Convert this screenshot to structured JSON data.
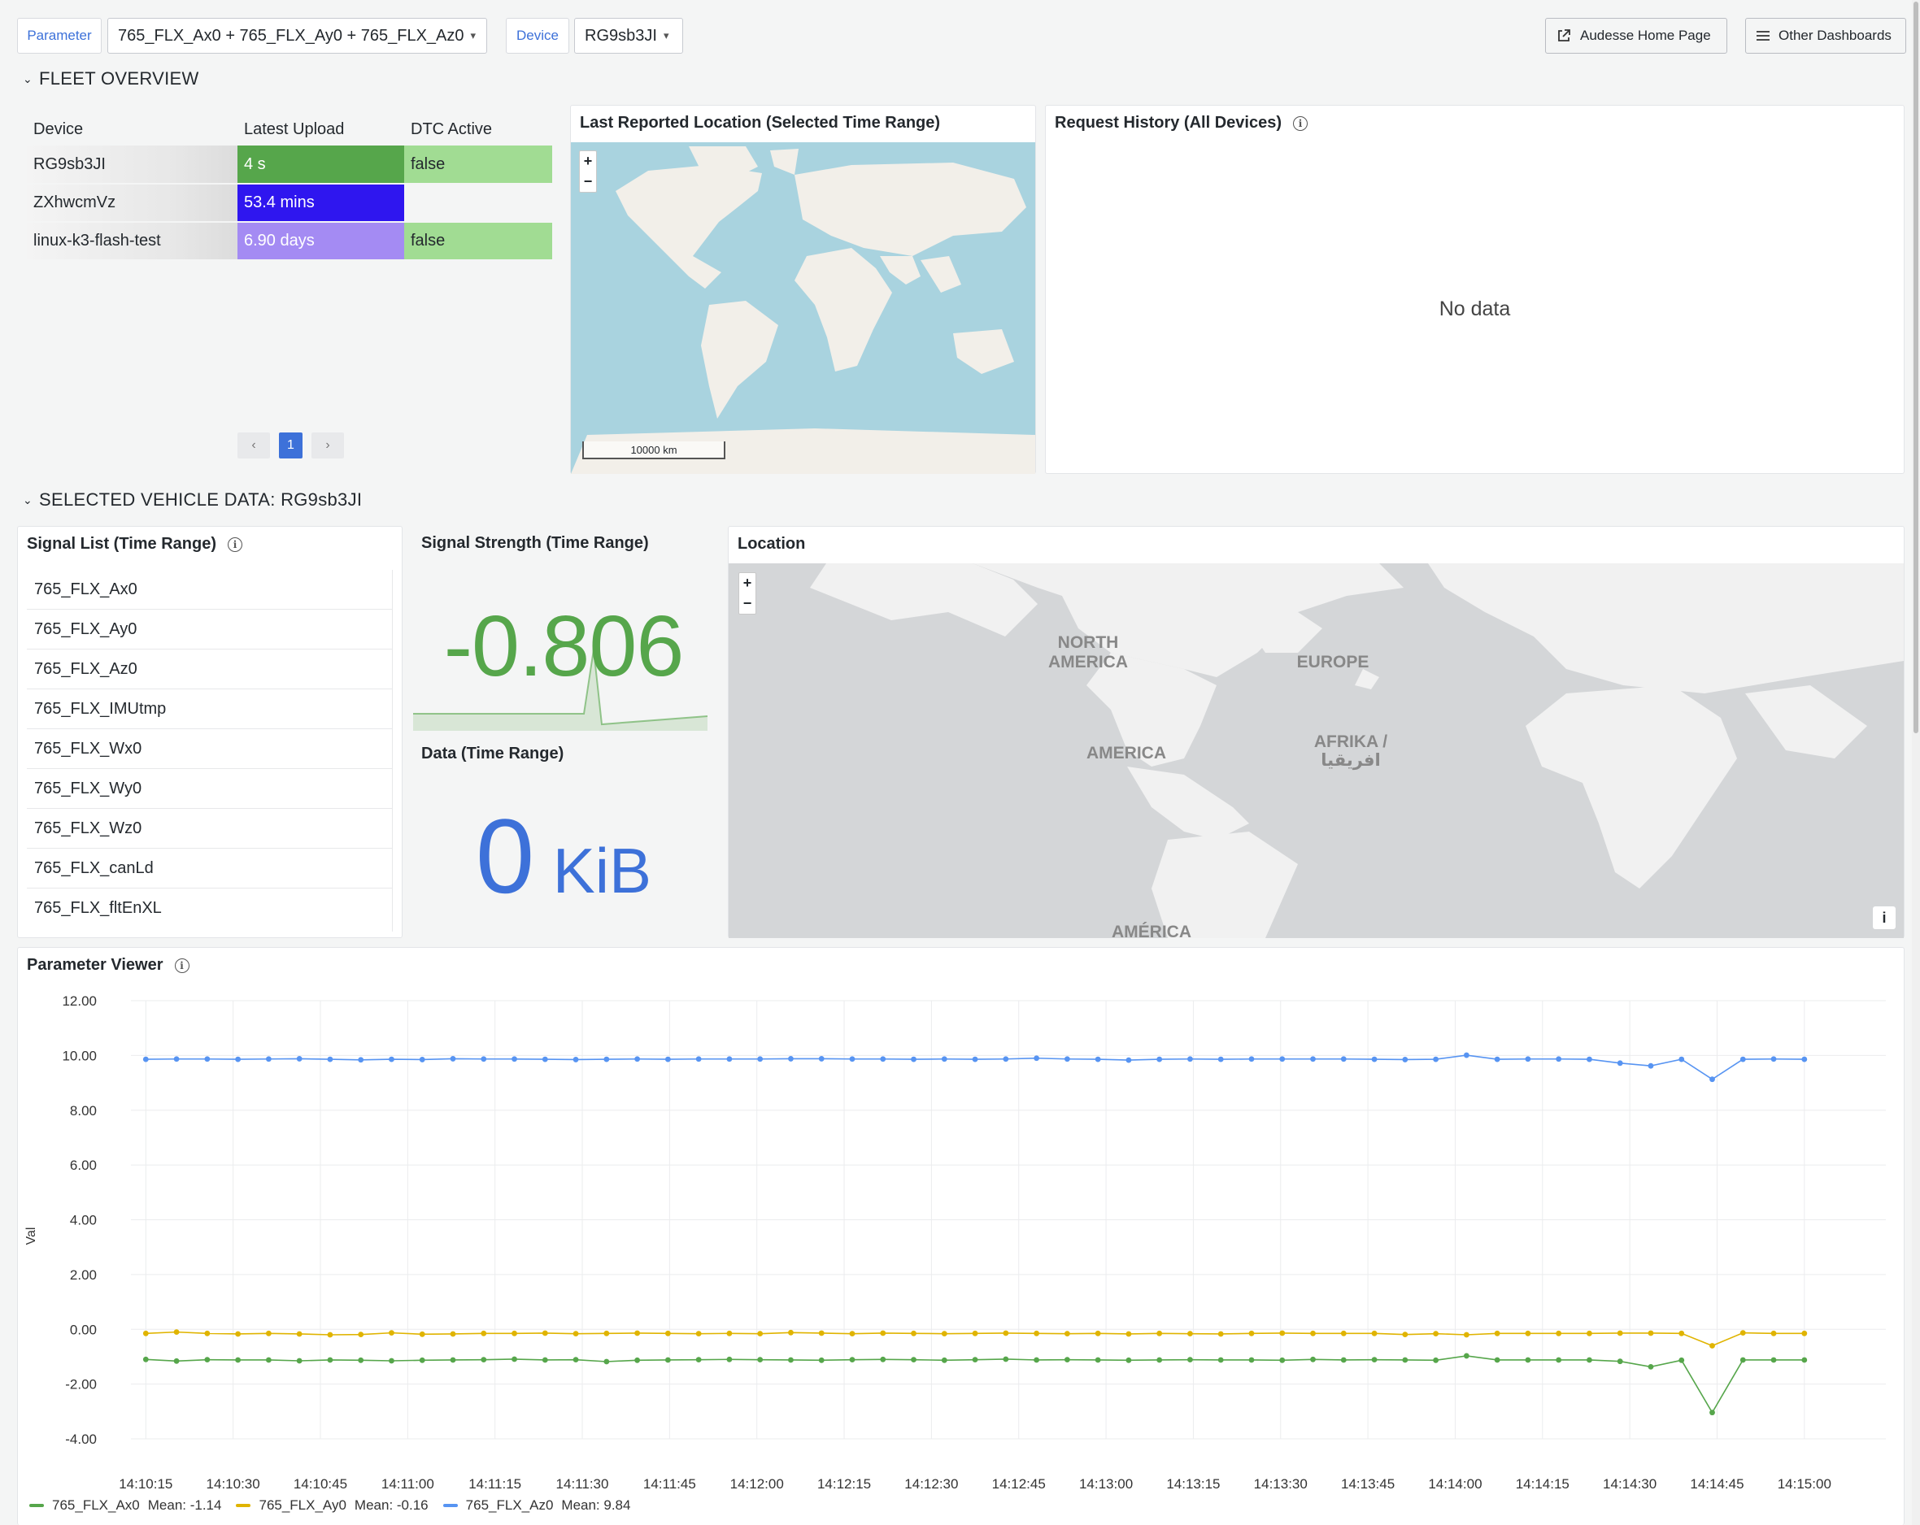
{
  "toolbar": {
    "parameter_label": "Parameter",
    "parameter_value": "765_FLX_Ax0 + 765_FLX_Ay0 + 765_FLX_Az0",
    "device_label": "Device",
    "device_value": "RG9sb3JI",
    "home_button": "Audesse Home Page",
    "dashboards_button": "Other Dashboards"
  },
  "fleet_overview": {
    "title": "FLEET OVERVIEW",
    "table": {
      "headers": [
        "Device",
        "Latest Upload",
        "DTC Active"
      ],
      "rows": [
        {
          "device": "RG9sb3JI",
          "upload": "4 s",
          "dtc": "false",
          "upload_color": "#56a64b",
          "dtc_color": "#a1dc93"
        },
        {
          "device": "ZXhwcmVz",
          "upload": "53.4 mins",
          "dtc": "",
          "upload_color": "#2f16ef",
          "dtc_color": "#f4f5f5"
        },
        {
          "device": "linux-k3-flash-test",
          "upload": "6.90 days",
          "dtc": "false",
          "upload_color": "#a48bf3",
          "dtc_color": "#a1dc93"
        }
      ],
      "page": "1"
    },
    "map_panel": {
      "title": "Last Reported Location (Selected Time Range)",
      "scale": "10000 km",
      "zoom_in": "+",
      "zoom_out": "−"
    },
    "request_panel": {
      "title": "Request History (All Devices)",
      "empty_text": "No data"
    }
  },
  "vehicle": {
    "title": "SELECTED VEHICLE DATA: RG9sb3JI",
    "signal_list": {
      "title": "Signal List (Time Range)",
      "items": [
        "765_FLX_Ax0",
        "765_FLX_Ay0",
        "765_FLX_Az0",
        "765_FLX_IMUtmp",
        "765_FLX_Wx0",
        "765_FLX_Wy0",
        "765_FLX_Wz0",
        "765_FLX_canLd",
        "765_FLX_fltEnXL"
      ]
    },
    "signal_strength": {
      "title": "Signal Strength (Time Range)",
      "value": "-0.806",
      "color": "#56a64b"
    },
    "data_panel": {
      "title": "Data (Time Range)",
      "value": "0",
      "unit": "KiB",
      "color": "#3d71d9"
    },
    "location": {
      "title": "Location",
      "zoom_in": "+",
      "zoom_out": "−",
      "info": "i",
      "labels": {
        "north_america_1": "NORTH",
        "north_america_2": "AMERICA",
        "europe": "EUROPE",
        "america": "AMERICA",
        "afrika_1": "AFRIKA /",
        "afrika_2": "افريقيا",
        "america_bottom": "AMÉRICA"
      }
    }
  },
  "parameter_viewer": {
    "title": "Parameter Viewer",
    "legend": [
      {
        "name": "765_FLX_Ax0",
        "mean": "Mean: -1.14",
        "color": "#56a64b"
      },
      {
        "name": "765_FLX_Ay0",
        "mean": "Mean: -0.16",
        "color": "#e0b400"
      },
      {
        "name": "765_FLX_Az0",
        "mean": "Mean: 9.84",
        "color": "#5794f2"
      }
    ]
  },
  "chart_data": {
    "type": "line",
    "title": "Parameter Viewer",
    "xlabel": "",
    "ylabel": "Val",
    "ylim": [
      -4,
      12
    ],
    "yticks": [
      "12.00",
      "10.00",
      "8.00",
      "6.00",
      "4.00",
      "2.00",
      "0.00",
      "-2.00",
      "-4.00"
    ],
    "xticks": [
      "14:10:15",
      "14:10:30",
      "14:10:45",
      "14:11:00",
      "14:11:15",
      "14:11:30",
      "14:11:45",
      "14:12:00",
      "14:12:15",
      "14:12:30",
      "14:12:45",
      "14:13:00",
      "14:13:15",
      "14:13:30",
      "14:13:45",
      "14:14:00",
      "14:14:15",
      "14:14:30",
      "14:14:45",
      "14:15:00"
    ],
    "x_start": "14:10:15",
    "x_end": "14:15:00",
    "grid": true,
    "legend_position": "bottom-left",
    "series": [
      {
        "name": "765_FLX_Az0",
        "color": "#5794f2",
        "values": [
          9.86,
          9.87,
          9.87,
          9.86,
          9.87,
          9.88,
          9.86,
          9.84,
          9.86,
          9.85,
          9.88,
          9.87,
          9.87,
          9.86,
          9.85,
          9.86,
          9.87,
          9.86,
          9.87,
          9.87,
          9.87,
          9.88,
          9.88,
          9.87,
          9.87,
          9.86,
          9.87,
          9.86,
          9.87,
          9.9,
          9.87,
          9.86,
          9.83,
          9.86,
          9.87,
          9.86,
          9.87,
          9.87,
          9.87,
          9.87,
          9.86,
          9.85,
          9.86,
          10.01,
          9.86,
          9.87,
          9.87,
          9.86,
          9.72,
          9.62,
          9.86,
          9.13,
          9.86,
          9.87,
          9.86
        ]
      },
      {
        "name": "765_FLX_Ay0",
        "color": "#e0b400",
        "values": [
          -0.15,
          -0.1,
          -0.15,
          -0.17,
          -0.15,
          -0.17,
          -0.2,
          -0.19,
          -0.13,
          -0.18,
          -0.17,
          -0.15,
          -0.15,
          -0.14,
          -0.16,
          -0.15,
          -0.14,
          -0.15,
          -0.16,
          -0.15,
          -0.16,
          -0.12,
          -0.14,
          -0.16,
          -0.14,
          -0.15,
          -0.16,
          -0.15,
          -0.14,
          -0.15,
          -0.16,
          -0.15,
          -0.17,
          -0.15,
          -0.16,
          -0.17,
          -0.15,
          -0.14,
          -0.15,
          -0.15,
          -0.15,
          -0.19,
          -0.16,
          -0.2,
          -0.15,
          -0.15,
          -0.15,
          -0.15,
          -0.14,
          -0.14,
          -0.15,
          -0.6,
          -0.13,
          -0.15,
          -0.15
        ]
      },
      {
        "name": "765_FLX_Ax0",
        "color": "#56a64b",
        "values": [
          -1.1,
          -1.16,
          -1.11,
          -1.12,
          -1.12,
          -1.15,
          -1.12,
          -1.13,
          -1.15,
          -1.13,
          -1.12,
          -1.11,
          -1.09,
          -1.12,
          -1.11,
          -1.18,
          -1.13,
          -1.12,
          -1.11,
          -1.1,
          -1.11,
          -1.12,
          -1.13,
          -1.11,
          -1.1,
          -1.11,
          -1.13,
          -1.11,
          -1.09,
          -1.12,
          -1.11,
          -1.12,
          -1.13,
          -1.12,
          -1.11,
          -1.12,
          -1.12,
          -1.13,
          -1.1,
          -1.12,
          -1.11,
          -1.12,
          -1.13,
          -0.97,
          -1.12,
          -1.12,
          -1.12,
          -1.12,
          -1.17,
          -1.37,
          -1.13,
          -3.04,
          -1.12,
          -1.12,
          -1.12
        ]
      }
    ]
  }
}
